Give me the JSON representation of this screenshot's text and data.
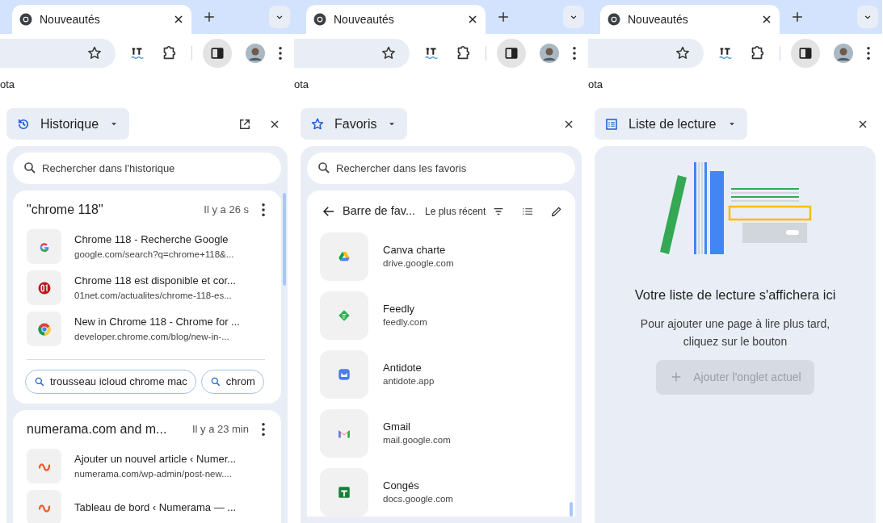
{
  "panels": [
    {
      "tab": {
        "title": "Nouveautés"
      },
      "bookmarks_bar_text": "ota",
      "side_panel": {
        "kind": "history",
        "title": "Historique",
        "search": {
          "placeholder": "Rechercher dans l'historique"
        },
        "groups": [
          {
            "title": "\"chrome 118\"",
            "time": "Il y a 26 s",
            "items": [
              {
                "title": "Chrome 118 - Recherche Google",
                "url": "google.com/search?q=chrome+118&..."
              },
              {
                "title": "Chrome 118 est disponible et cor...",
                "url": "01net.com/actualites/chrome-118-es..."
              },
              {
                "title": "New in Chrome 118 - Chrome for ...",
                "url": "developer.chrome.com/blog/new-in-..."
              }
            ],
            "related_searches": [
              "trousseau icloud chrome mac",
              "chrom"
            ]
          },
          {
            "title": "numerama.com and m...",
            "time": "Il y a 23 min",
            "items": [
              {
                "title": "Ajouter un nouvel article ‹ Numer...",
                "url": "numerama.com/wp-admin/post-new...."
              },
              {
                "title": "Tableau de bord ‹ Numerama — ..."
              }
            ]
          }
        ]
      }
    },
    {
      "tab": {
        "title": "Nouveautés"
      },
      "bookmarks_bar_text": "ota",
      "side_panel": {
        "kind": "bookmarks",
        "title": "Favoris",
        "search": {
          "placeholder": "Rechercher dans les favoris"
        },
        "folder": "Barre de fav...",
        "sort": "Le plus récent",
        "items": [
          {
            "title": "Canva charte",
            "url": "drive.google.com"
          },
          {
            "title": "Feedly",
            "url": "feedly.com"
          },
          {
            "title": "Antidote",
            "url": "antidote.app"
          },
          {
            "title": "Gmail",
            "url": "mail.google.com"
          },
          {
            "title": "Congés",
            "url": "docs.google.com"
          }
        ]
      }
    },
    {
      "tab": {
        "title": "Nouveautés"
      },
      "bookmarks_bar_text": "ota",
      "side_panel": {
        "kind": "reading_list",
        "title": "Liste de lecture",
        "heading": "Votre liste de lecture s'affichera ici",
        "body": "Pour ajouter une page à lire plus tard, cliquez sur le bouton",
        "button": {
          "label": "Ajouter l'onglet actuel",
          "disabled": true
        }
      }
    }
  ]
}
